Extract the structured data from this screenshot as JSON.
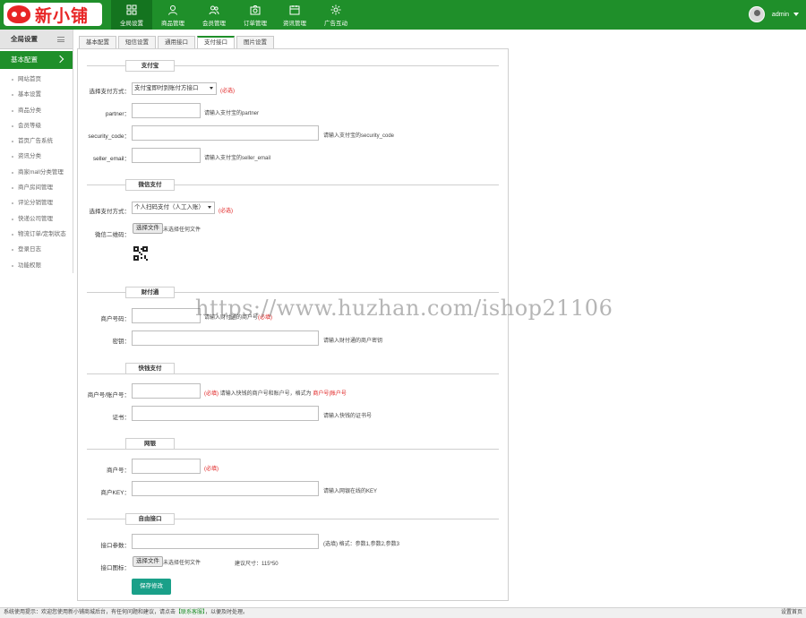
{
  "brand": {
    "logo_text": "新小铺",
    "accent": "#1f8f2a"
  },
  "nav": [
    {
      "label": "全局设置",
      "icon": "grid-icon",
      "active": true
    },
    {
      "label": "商品管理",
      "icon": "user-icon"
    },
    {
      "label": "会员管理",
      "icon": "people-icon"
    },
    {
      "label": "订单管理",
      "icon": "camera-icon"
    },
    {
      "label": "资讯管理",
      "icon": "calendar-icon"
    },
    {
      "label": "广告互动",
      "icon": "gear-icon"
    }
  ],
  "user": {
    "name": "admin"
  },
  "sidebar": {
    "title": "全局设置",
    "active_item": "基本配置",
    "items": [
      "网站首页",
      "基本设置",
      "商品分类",
      "会员等级",
      "首页广告系统",
      "资讯分类",
      "商家mall分类管理",
      "商户房间管理",
      "评论分销管理",
      "快递公司管理",
      "物流订单/定制状态",
      "登录日志",
      "功能权限"
    ]
  },
  "tabs": [
    {
      "label": "基本配置"
    },
    {
      "label": "短信设置"
    },
    {
      "label": "通用接口"
    },
    {
      "label": "支付接口",
      "active": true
    },
    {
      "label": "图片设置"
    }
  ],
  "sections": {
    "alipay": {
      "title": "支付宝",
      "type_label": "选择支付方式：",
      "type_value": "支付宝即时到账付方接口",
      "type_req": "(必选)",
      "partner_label": "partner：",
      "partner_hint": "请输入支付宝的partner",
      "code_label": "security_code：",
      "code_hint": "请输入支付宝的security_code",
      "email_label": "seller_email：",
      "email_hint": "请输入支付宝的seller_email"
    },
    "wechat": {
      "title": "微信支付",
      "type_label": "选择支付方式：",
      "type_value": "个人扫码支付（人工入账）",
      "type_req": "(必选)",
      "qr_label": "微信二维码：",
      "file_btn": "选择文件",
      "file_status": "未选择任何文件"
    },
    "tenpay": {
      "title": "财付通",
      "merchant_label": "商户号码：",
      "merchant_hint": "请输入财付通的商户号",
      "merchant_req": "(必填)",
      "key_label": "密钥：",
      "key_hint": "请输入财付通的商户密钥"
    },
    "kuaiqian": {
      "title": "快钱支付",
      "acct_label": "商户号/账户号：",
      "acct_req": "(必填)",
      "acct_hint": "请输入快钱的商户号和账户号，格式为",
      "acct_hint_red": "商户号|账户号",
      "cert_label": "证书：",
      "cert_hint": "请输入快钱的证书号"
    },
    "chinabank": {
      "title": "网银",
      "merchant_label": "商户号：",
      "merchant_req": "(必填)",
      "key_label": "商户KEY：",
      "key_hint": "请输入网银在线的KEY"
    },
    "custom": {
      "title": "自由接口",
      "params_label": "接口参数：",
      "params_hint": "(选填) 格式：参数1,参数2,参数3",
      "icon_label": "接口图标：",
      "file_btn": "选择文件",
      "file_status": "未选择任何文件",
      "size_hint": "建议尺寸：115*50"
    }
  },
  "save_label": "保存修改",
  "watermark": "https://www.huzhan.com/ishop21106",
  "footer": {
    "prefix": "系统使用提示：欢迎您使用新小铺商城后台，有任何问题和建议，请点击",
    "link": "【联系客服】",
    "suffix": "，以便及时处理。",
    "right": "设置首页"
  }
}
